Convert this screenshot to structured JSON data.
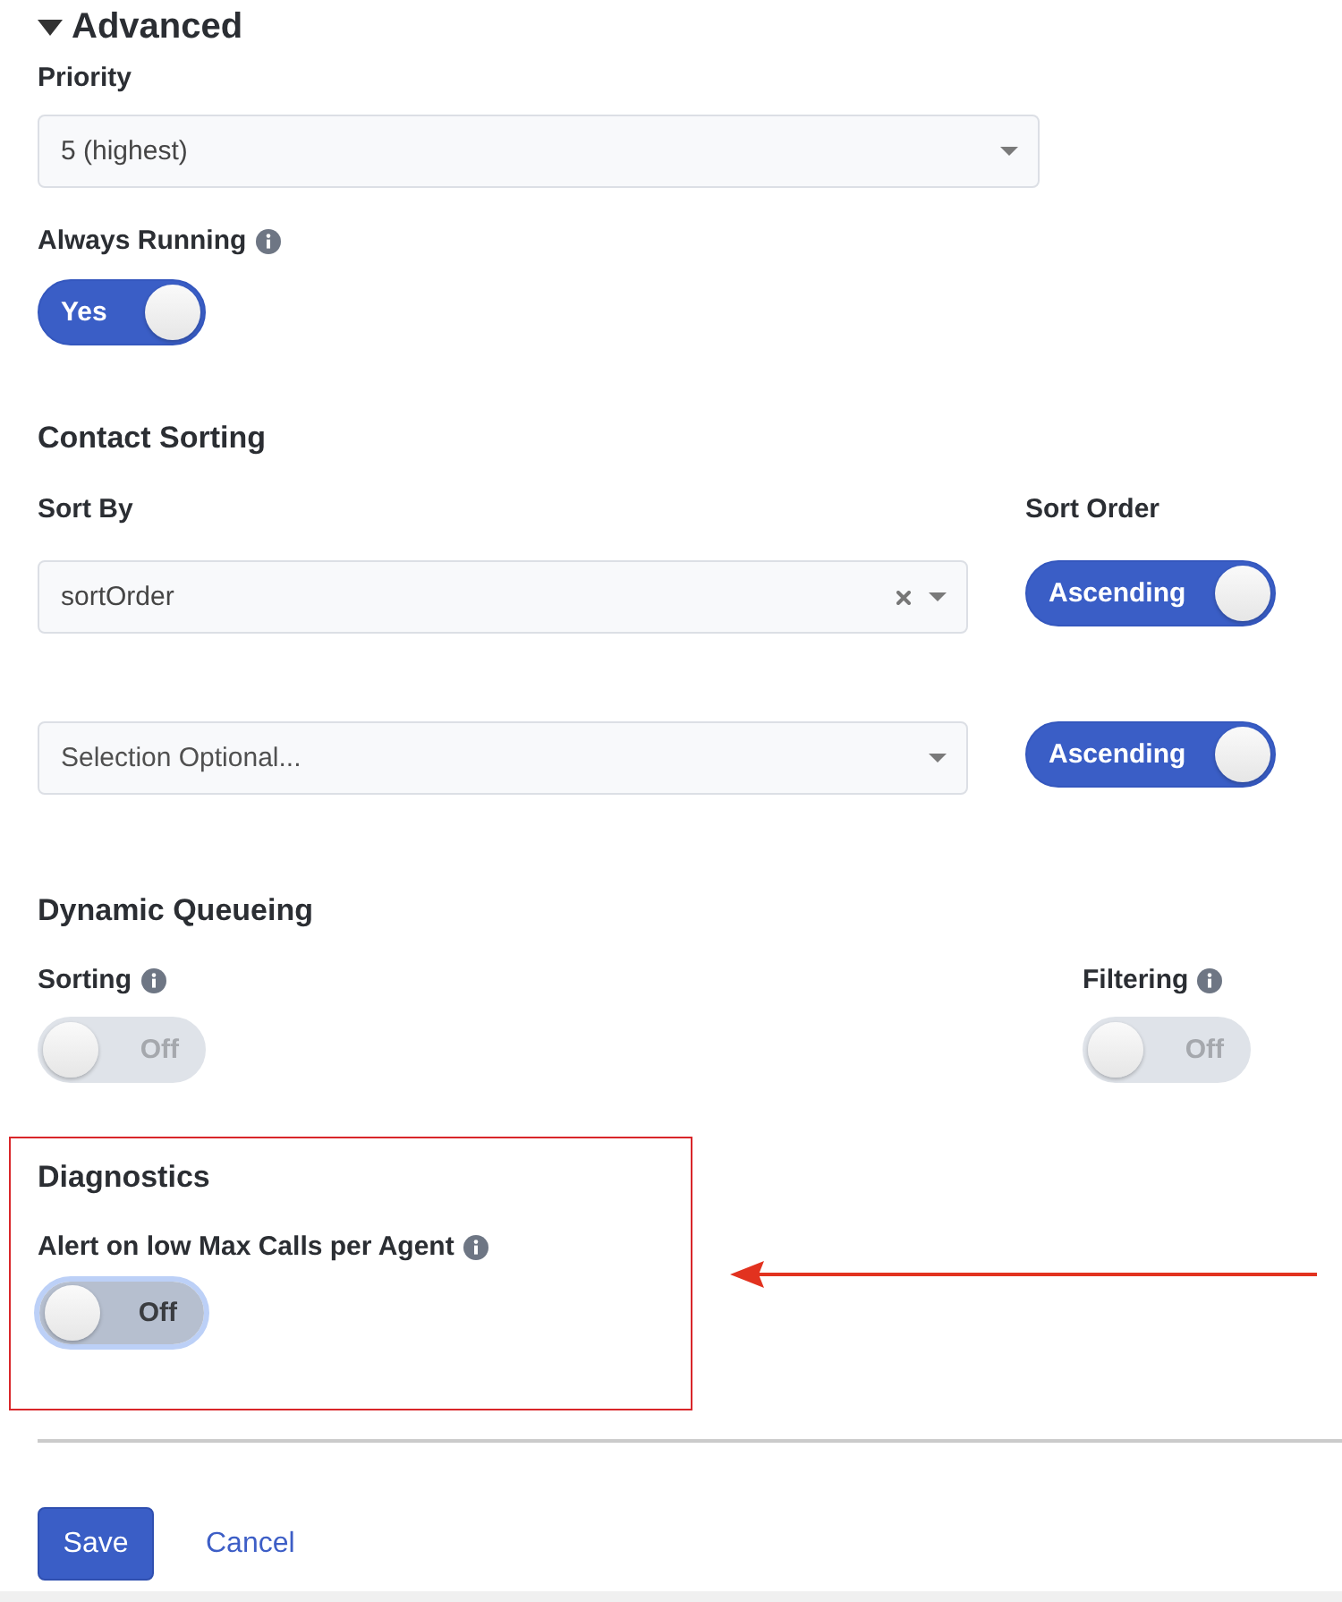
{
  "section": {
    "title": "Advanced",
    "expanded": true
  },
  "priority": {
    "label": "Priority",
    "select": {
      "value": "5 (highest)"
    }
  },
  "always_running": {
    "label": "Always Running",
    "toggle": {
      "text": "Yes",
      "on": true,
      "disabled": false
    }
  },
  "contact_sorting": {
    "title": "Contact Sorting",
    "sort_by_label": "Sort By",
    "sort_order_label": "Sort Order",
    "rows": [
      {
        "select": {
          "value": "sortOrder",
          "clearable": true
        },
        "toggle": {
          "text": "Ascending",
          "on": true,
          "disabled": false
        }
      },
      {
        "select": {
          "placeholder": "Selection Optional..."
        },
        "toggle": {
          "text": "Ascending",
          "on": true,
          "disabled": false
        }
      }
    ]
  },
  "dynamic_queueing": {
    "title": "Dynamic Queueing",
    "options": [
      {
        "label": "Sorting",
        "toggle": {
          "text": "Off",
          "on": false,
          "disabled": true
        }
      },
      {
        "label": "Filtering",
        "toggle": {
          "text": "Off",
          "on": false,
          "disabled": true
        }
      }
    ]
  },
  "diagnostics": {
    "title": "Diagnostics",
    "highlighted": true,
    "option": {
      "label": "Alert on low Max Calls per Agent",
      "toggle": {
        "text": "Off",
        "on": false,
        "disabled": false,
        "focused": true
      }
    }
  },
  "actions": {
    "save": "Save",
    "cancel": "Cancel"
  }
}
